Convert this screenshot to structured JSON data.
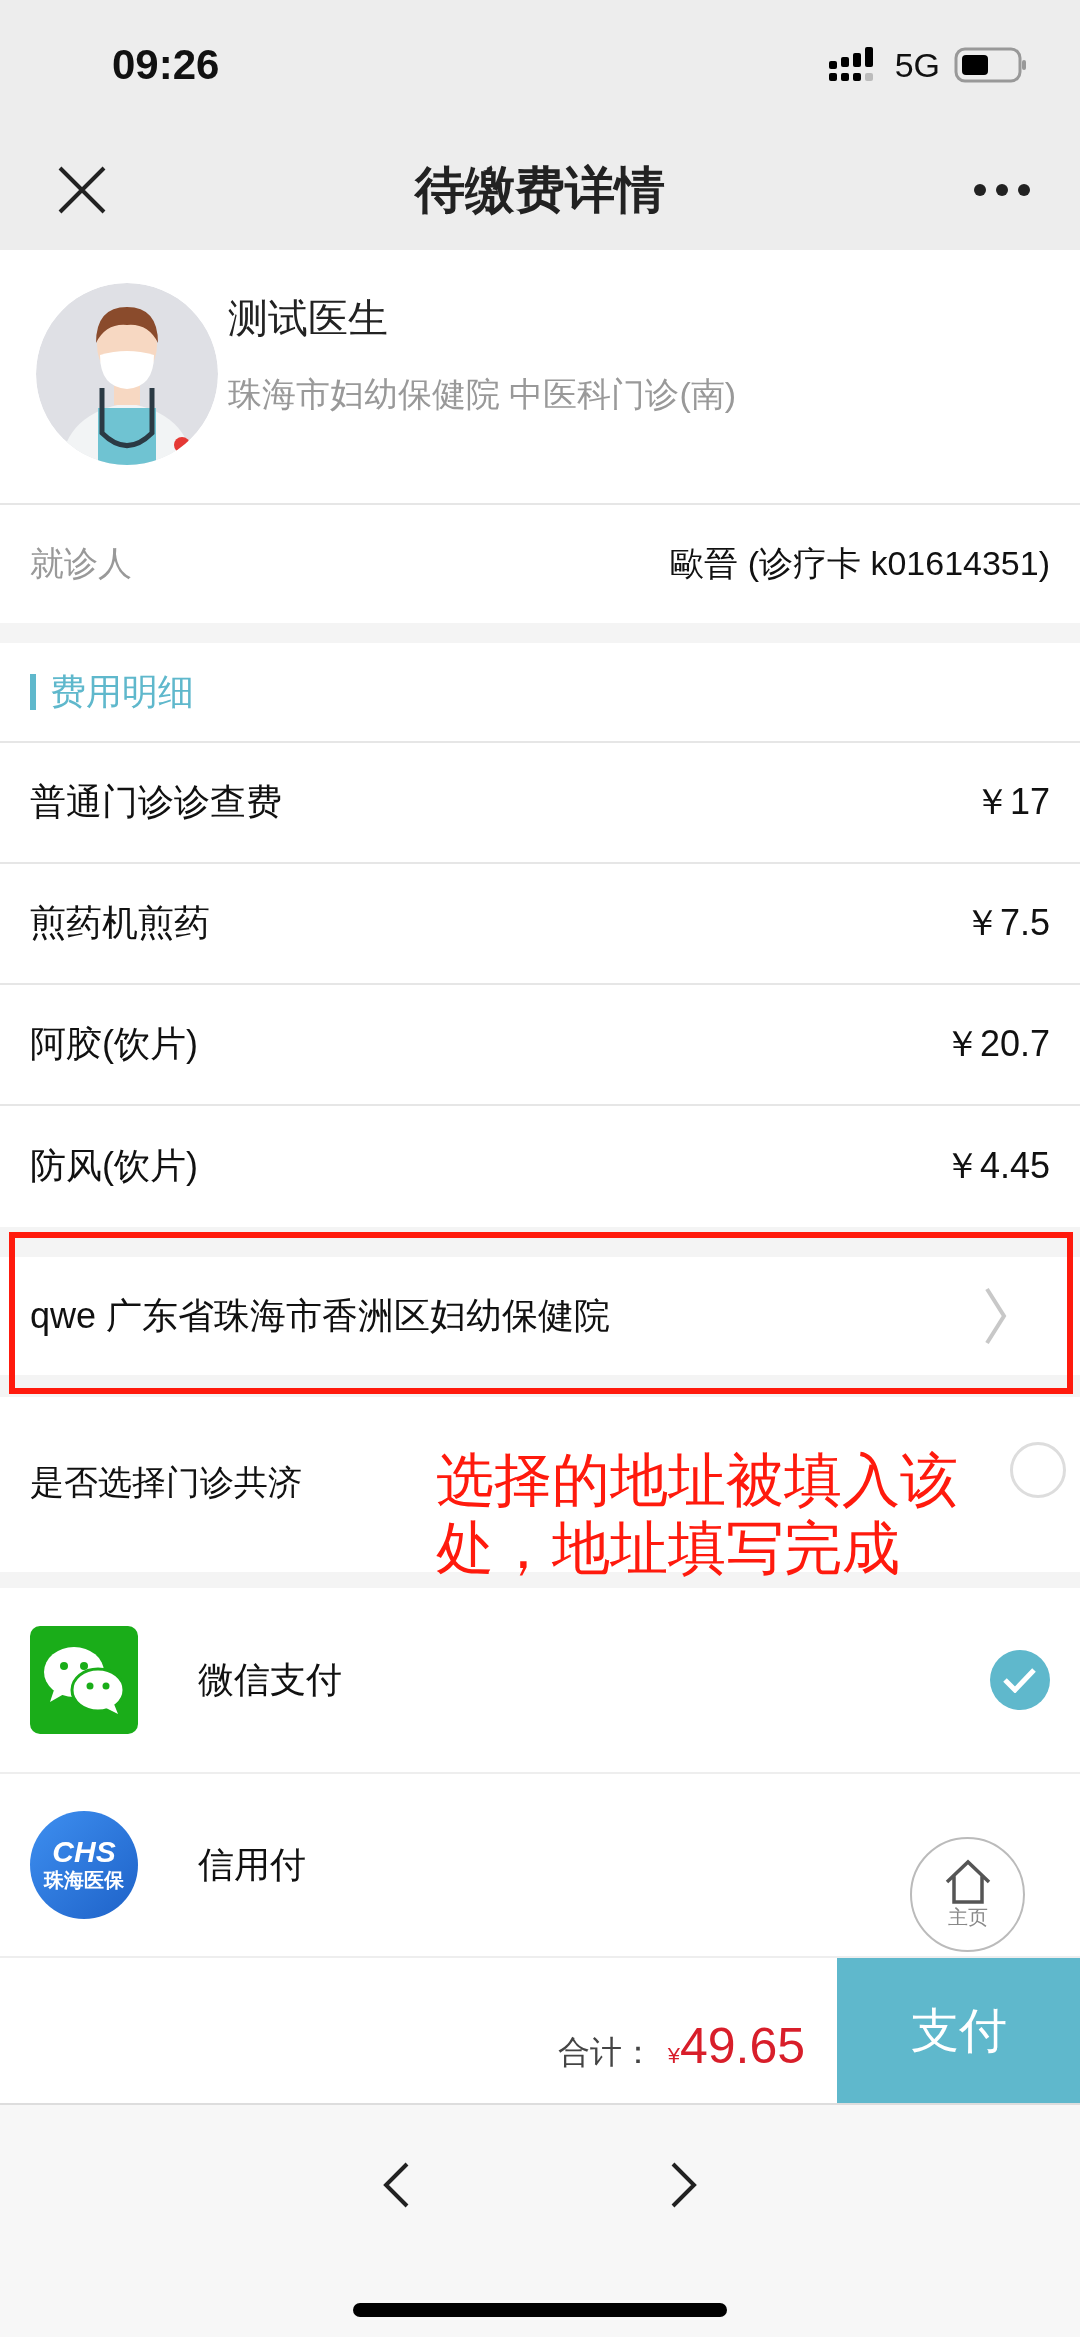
{
  "status_bar": {
    "time": "09:26",
    "network": "5G"
  },
  "nav": {
    "title": "待缴费详情"
  },
  "doctor": {
    "name": "测试医生",
    "department": "珠海市妇幼保健院 中医科门诊(南)"
  },
  "patient": {
    "label": "就诊人",
    "value": "歐晉 (诊疗卡 k01614351)"
  },
  "fees": {
    "title": "费用明细",
    "items": [
      {
        "name": "普通门诊诊查费",
        "amount": "￥17"
      },
      {
        "name": "煎药机煎药",
        "amount": "￥7.5"
      },
      {
        "name": "阿胶(饮片)",
        "amount": "￥20.7"
      },
      {
        "name": "防风(饮片)",
        "amount": "￥4.45"
      }
    ]
  },
  "address": {
    "text": "qwe 广东省珠海市香洲区妇幼保健院"
  },
  "annotation": {
    "text": "选择的地址被填入该处，地址填写完成"
  },
  "mutual_aid": {
    "label": "是否选择门诊共济",
    "checked": false
  },
  "payment_methods": [
    {
      "kind": "wechat",
      "name": "微信支付",
      "selected": true
    },
    {
      "kind": "chs",
      "name": "信用付",
      "selected": false,
      "logo_title": "CHS",
      "logo_subtitle": "珠海医保"
    }
  ],
  "home_button": {
    "label": "主页"
  },
  "footer": {
    "total_label": "合计：",
    "currency": "¥",
    "total": "49.65",
    "pay_button": "支付"
  }
}
